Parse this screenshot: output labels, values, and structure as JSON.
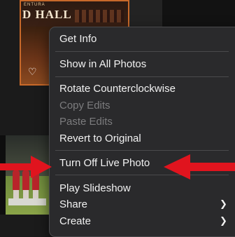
{
  "background": {
    "top_thumbnail": {
      "banner_small_text": "ENTURA",
      "banner_big_text": "D HALL",
      "heart_icon": "heart-outline-icon"
    }
  },
  "context_menu": {
    "items": [
      {
        "label": "Get Info",
        "enabled": true
      },
      {
        "label": "Show in All Photos",
        "enabled": true
      },
      {
        "label": "Rotate Counterclockwise",
        "enabled": true
      },
      {
        "label": "Copy Edits",
        "enabled": false
      },
      {
        "label": "Paste Edits",
        "enabled": false
      },
      {
        "label": "Revert to Original",
        "enabled": true
      },
      {
        "label": "Turn Off Live Photo",
        "enabled": true,
        "highlighted_by_annotation": true
      },
      {
        "label": "Play Slideshow",
        "enabled": true
      },
      {
        "label": "Share",
        "enabled": true,
        "submenu": true
      },
      {
        "label": "Create",
        "enabled": true,
        "submenu": true
      }
    ],
    "submenu_icon": "chevron-right-icon"
  },
  "annotations": {
    "color": "#e0141e",
    "arrows": [
      "left-arrow-pointing-right",
      "right-arrow-pointing-left"
    ]
  },
  "colors": {
    "menu_background": "#2a2a2c",
    "menu_text": "#f2f2f2",
    "menu_text_disabled": "#7c7c7e",
    "annotation_red": "#e0141e"
  }
}
